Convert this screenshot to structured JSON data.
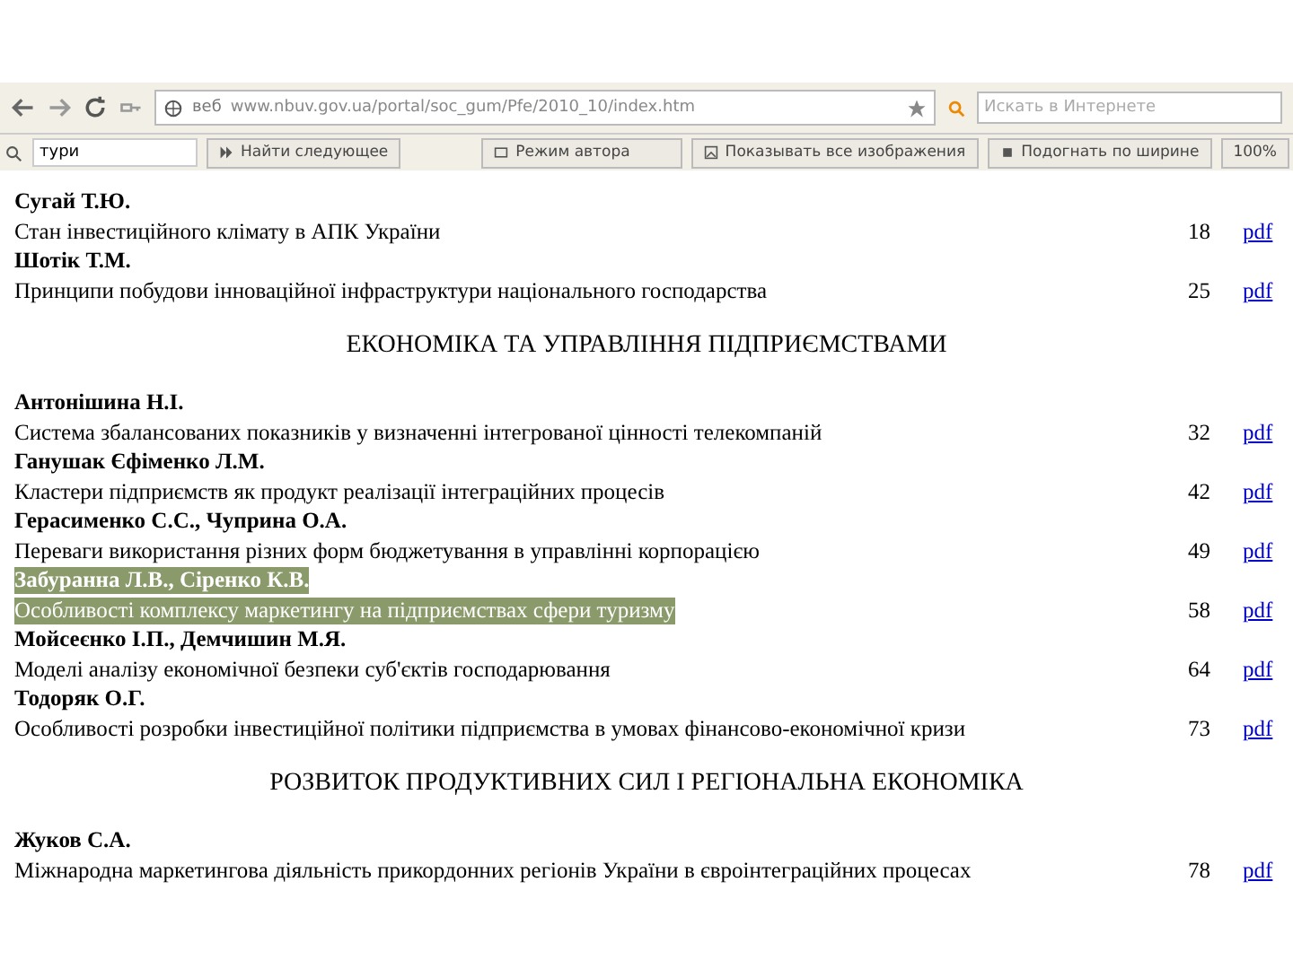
{
  "browser": {
    "address_prefix": "веб",
    "url": "www.nbuv.gov.ua/portal/soc_gum/Pfe/2010_10/index.htm",
    "search_placeholder": "Искать в Интернете"
  },
  "find_bar": {
    "query": "тури",
    "buttons": [
      {
        "kind": "next",
        "label": "Найти следующее"
      },
      {
        "kind": "mode",
        "label": "Режим автора"
      },
      {
        "kind": "images",
        "label": "Показывать все изображения"
      },
      {
        "kind": "fit",
        "label": "Подогнать по ширине"
      }
    ],
    "zoom": "100%"
  },
  "sections": [
    {
      "entries": [
        {
          "authors": "Сугай Т.Ю.",
          "title": "Стан інвестиційного клімату в АПК України",
          "page": "18",
          "link": "pdf",
          "selected": false
        },
        {
          "authors": "Шотік Т.М.",
          "title": "Принципи побудови інноваційної інфраструктури національного господарства",
          "page": "25",
          "link": "pdf",
          "selected": false
        }
      ]
    },
    {
      "title": "ЕКОНОМІКА ТА УПРАВЛІННЯ ПІДПРИЄМСТВАМИ",
      "entries": [
        {
          "authors": "Антонішина Н.І.",
          "title": "Система збалансованих показників у визначенні інтегрованої цінності телекомпаній",
          "page": "32",
          "link": "pdf",
          "selected": false
        },
        {
          "authors": "Ганушак Єфіменко Л.М.",
          "title": "Кластери підприємств як продукт реалізації інтеграційних процесів",
          "page": "42",
          "link": "pdf",
          "selected": false
        },
        {
          "authors": "Герасименко С.С., Чуприна О.А.",
          "title": "Переваги використання різних форм бюджетування в управлінні корпорацією",
          "page": "49",
          "link": "pdf",
          "selected": false
        },
        {
          "authors": "Забуранна Л.В., Сіренко К.В.",
          "title": "Особливості комплексу маркетингу на підприємствах сфери туризму",
          "page": "58",
          "link": "pdf",
          "selected": true
        },
        {
          "authors": "Мойсеєнко І.П., Демчишин М.Я.",
          "title": "Моделі аналізу економічної безпеки суб'єктів господарювання",
          "page": "64",
          "link": "pdf",
          "selected": false
        },
        {
          "authors": "Тодоряк О.Г.",
          "title": "Особливості розробки інвестиційної політики підприємства в умовах фінансово-економічної кризи",
          "page": "73",
          "link": "pdf",
          "selected": false
        }
      ]
    },
    {
      "title": "РОЗВИТОК ПРОДУКТИВНИХ СИЛ І РЕГІОНАЛЬНА ЕКОНОМІКА",
      "entries": [
        {
          "authors": "Жуков С.А.",
          "title": "Міжнародна маркетингова діяльність прикордонних регіонів України в євроінтеграційних процесах",
          "page": "78",
          "link": "pdf",
          "selected": false
        }
      ]
    }
  ]
}
